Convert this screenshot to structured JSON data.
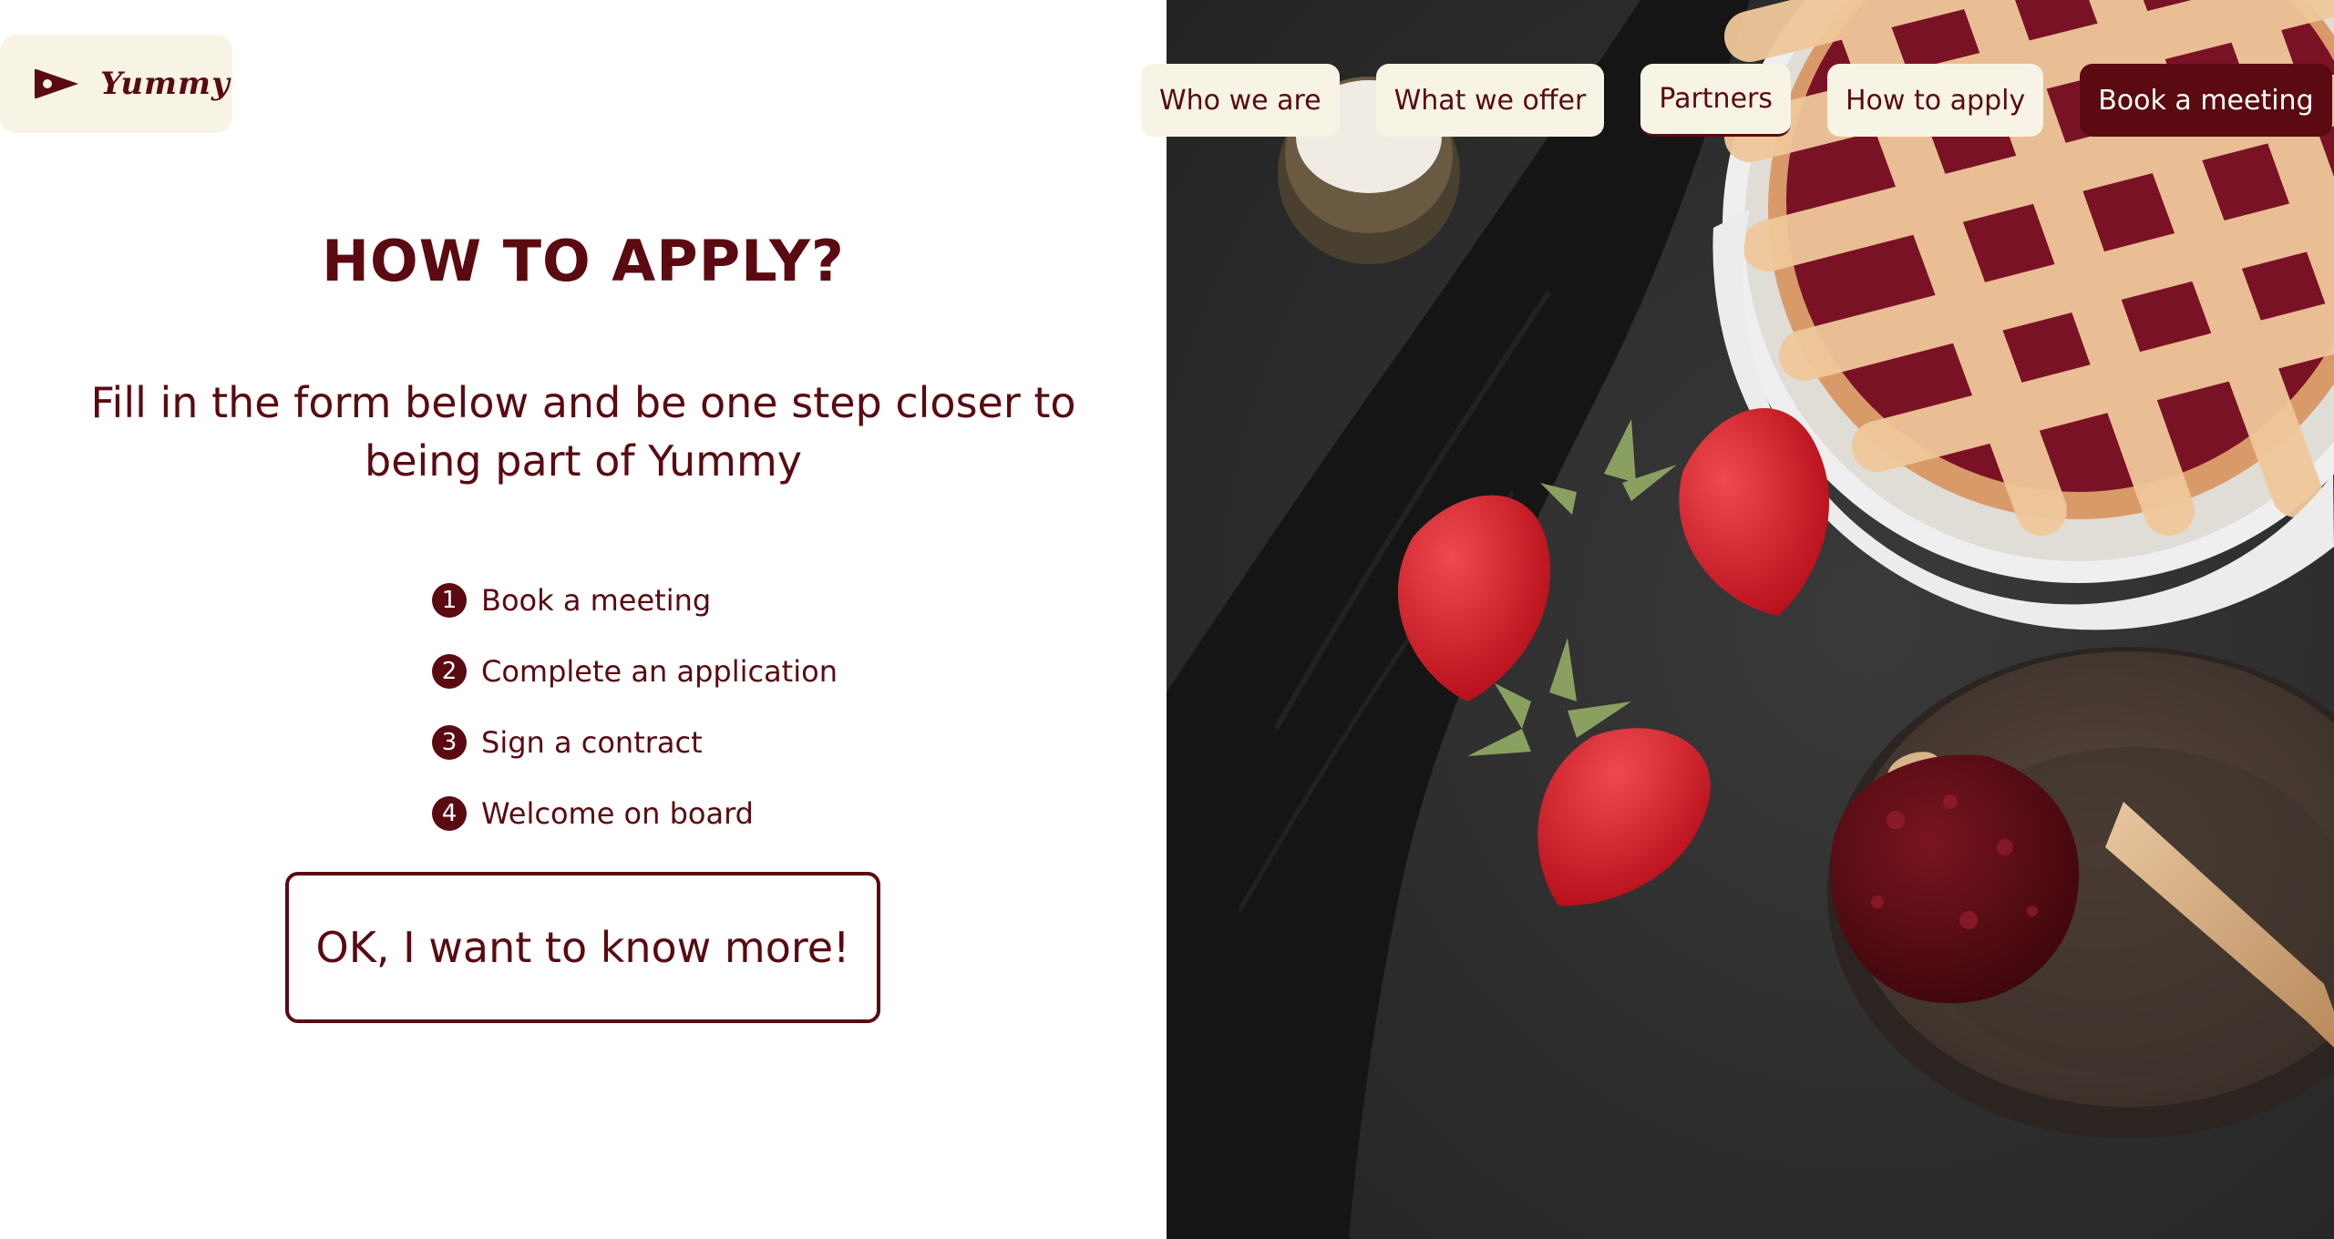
{
  "brand": {
    "name": "Yummy",
    "logo_icon": "play-flag-icon"
  },
  "nav": {
    "items": [
      {
        "label": "Who we are"
      },
      {
        "label": "What we offer"
      },
      {
        "label": "Partners"
      },
      {
        "label": "How to apply"
      },
      {
        "label": "Book a meeting"
      }
    ]
  },
  "main": {
    "title": "HOW TO APPLY?",
    "subtitle": "Fill in the form below and be one step closer to being part of Yummy",
    "steps": [
      {
        "number": "1",
        "label": "Book a meeting"
      },
      {
        "number": "2",
        "label": "Complete an application"
      },
      {
        "number": "3",
        "label": "Sign a contract"
      },
      {
        "number": "4",
        "label": "Welcome on board"
      }
    ],
    "cta_label": "OK, I want to know more!"
  },
  "colors": {
    "primary": "#5a0a10",
    "cream": "#f7f4e6",
    "background": "#ffffff",
    "photo_background": "#2b2b2b"
  }
}
